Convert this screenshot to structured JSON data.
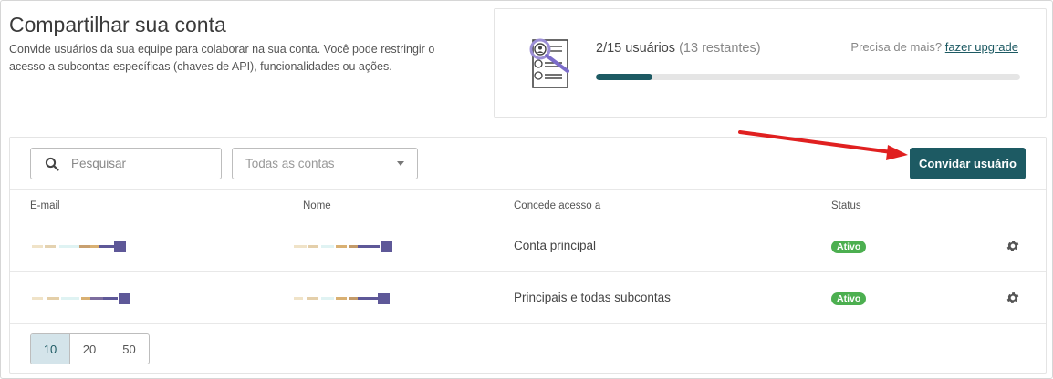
{
  "header": {
    "title": "Compartilhar sua conta",
    "description": "Convide usuários da sua equipe para colaborar na sua conta. Você pode restringir o acesso a subcontas específicas (chaves de API), funcionalidades ou ações."
  },
  "usage": {
    "count_text": "2/15 usuários",
    "remaining_text": "(13 restantes)",
    "used": 2,
    "total": 15,
    "progress_fraction": 0.133,
    "upgrade_prompt": "Precisa de mais?",
    "upgrade_link": "fazer upgrade"
  },
  "toolbar": {
    "search_placeholder": "Pesquisar",
    "account_filter": "Todas as contas",
    "invite_label": "Convidar usuário"
  },
  "table": {
    "headers": {
      "email": "E-mail",
      "name": "Nome",
      "access": "Concede acesso a",
      "status": "Status"
    },
    "rows": [
      {
        "access": "Conta principal",
        "status": "Ativo"
      },
      {
        "access": "Principais e todas subcontas",
        "status": "Ativo"
      }
    ]
  },
  "pagination": {
    "options": [
      "10",
      "20",
      "50"
    ],
    "selected": "10"
  },
  "colors": {
    "primary": "#1d5a63",
    "status_active": "#4caf50",
    "annotation_arrow": "#e02020"
  }
}
